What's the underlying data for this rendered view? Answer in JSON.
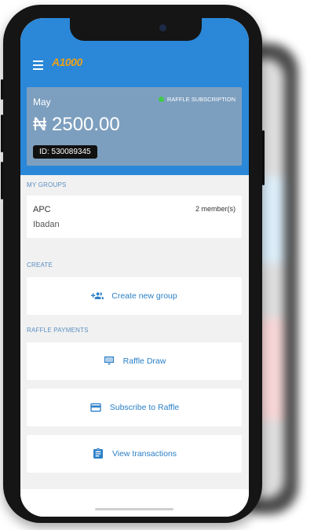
{
  "header": {
    "logo_text": "A1000",
    "menu_icon": "hamburger-icon"
  },
  "balance": {
    "month": "May",
    "amount": "₦ 2500.00",
    "subscription_label": "RAFFLE SUBSCRIPTION",
    "id_label": "ID: 530089345"
  },
  "sections": {
    "groups_title": "MY GROUPS",
    "create_title": "CREATE",
    "raffle_title": "RAFFLE PAYMENTS"
  },
  "group": {
    "name": "APC",
    "location": "Ibadan",
    "members": "2 member(s)"
  },
  "buttons": {
    "create_group": "Create new group",
    "raffle_draw": "Raffle Draw",
    "subscribe": "Subscribe to Raffle",
    "transactions": "View transactions"
  },
  "colors": {
    "primary": "#2b87d8",
    "card": "#7d9fbf",
    "status": "#3ecb4a"
  }
}
